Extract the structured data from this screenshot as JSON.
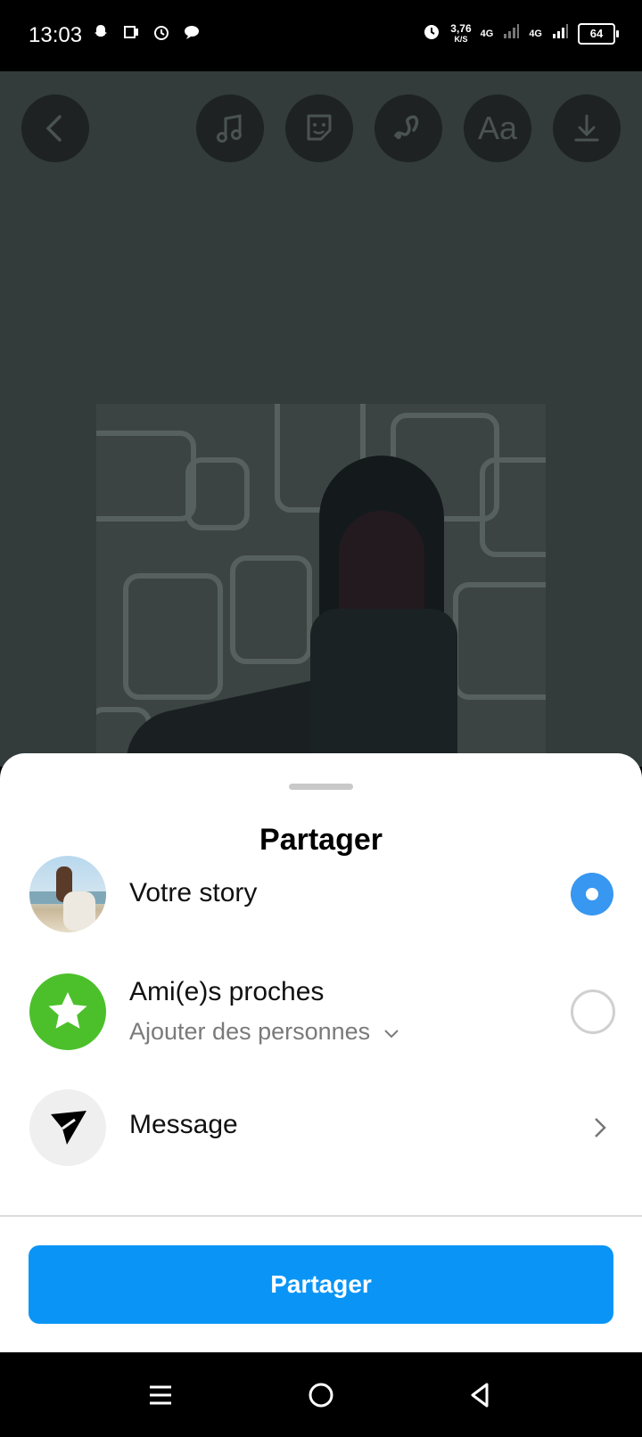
{
  "status_bar": {
    "time": "13:03",
    "speed_value": "3,76",
    "speed_unit": "K/S",
    "net1": "4G",
    "net2": "4G",
    "battery": "64"
  },
  "editor_toolbar": {
    "icons": [
      "back-icon",
      "music-icon",
      "sticker-icon",
      "draw-icon",
      "text-icon",
      "download-icon"
    ],
    "text_tool_label": "Aa"
  },
  "sheet": {
    "title": "Partager",
    "options": [
      {
        "label": "Votre story",
        "selected": true
      },
      {
        "label": "Ami(e)s proches",
        "sublabel": "Ajouter des personnes",
        "selected": false
      },
      {
        "label": "Message"
      }
    ],
    "share_button": "Partager"
  },
  "colors": {
    "accent": "#0a95f6",
    "radio_selected": "#3897f0",
    "close_friends_green": "#4cc02b",
    "editor_bg": "#333b3b"
  }
}
